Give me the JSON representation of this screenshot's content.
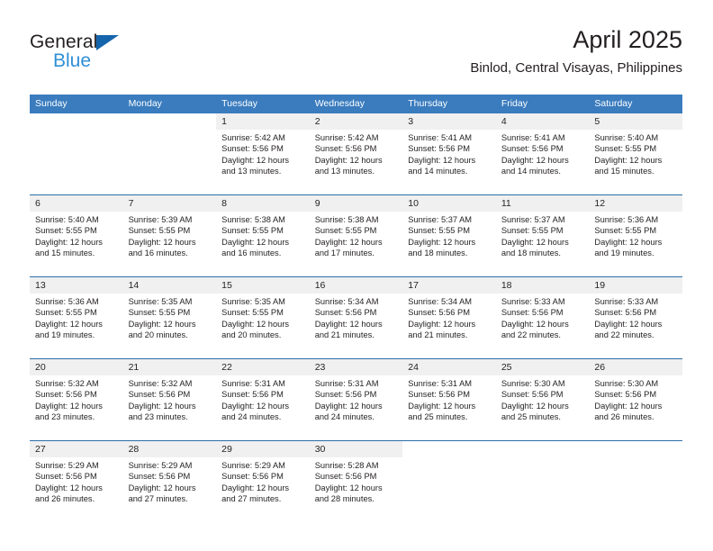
{
  "logo": {
    "primary_text": "General",
    "secondary_text": "Blue",
    "triangle_color": "#1565ad",
    "secondary_color": "#2f8fd6"
  },
  "header": {
    "title": "April 2025",
    "subtitle": "Binlod, Central Visayas, Philippines"
  },
  "theme": {
    "header_bar_color": "#3a7cbe",
    "week_divider_color": "#2e6da8",
    "date_band_color": "#f0f0f0",
    "text_color": "#231f20"
  },
  "day_headers": [
    "Sunday",
    "Monday",
    "Tuesday",
    "Wednesday",
    "Thursday",
    "Friday",
    "Saturday"
  ],
  "weeks": [
    {
      "days": [
        {
          "date": "",
          "empty": true
        },
        {
          "date": "",
          "empty": true
        },
        {
          "date": "1",
          "sunrise": "Sunrise: 5:42 AM",
          "sunset": "Sunset: 5:56 PM",
          "daylight": "Daylight: 12 hours and 13 minutes."
        },
        {
          "date": "2",
          "sunrise": "Sunrise: 5:42 AM",
          "sunset": "Sunset: 5:56 PM",
          "daylight": "Daylight: 12 hours and 13 minutes."
        },
        {
          "date": "3",
          "sunrise": "Sunrise: 5:41 AM",
          "sunset": "Sunset: 5:56 PM",
          "daylight": "Daylight: 12 hours and 14 minutes."
        },
        {
          "date": "4",
          "sunrise": "Sunrise: 5:41 AM",
          "sunset": "Sunset: 5:56 PM",
          "daylight": "Daylight: 12 hours and 14 minutes."
        },
        {
          "date": "5",
          "sunrise": "Sunrise: 5:40 AM",
          "sunset": "Sunset: 5:55 PM",
          "daylight": "Daylight: 12 hours and 15 minutes."
        }
      ]
    },
    {
      "days": [
        {
          "date": "6",
          "sunrise": "Sunrise: 5:40 AM",
          "sunset": "Sunset: 5:55 PM",
          "daylight": "Daylight: 12 hours and 15 minutes."
        },
        {
          "date": "7",
          "sunrise": "Sunrise: 5:39 AM",
          "sunset": "Sunset: 5:55 PM",
          "daylight": "Daylight: 12 hours and 16 minutes."
        },
        {
          "date": "8",
          "sunrise": "Sunrise: 5:38 AM",
          "sunset": "Sunset: 5:55 PM",
          "daylight": "Daylight: 12 hours and 16 minutes."
        },
        {
          "date": "9",
          "sunrise": "Sunrise: 5:38 AM",
          "sunset": "Sunset: 5:55 PM",
          "daylight": "Daylight: 12 hours and 17 minutes."
        },
        {
          "date": "10",
          "sunrise": "Sunrise: 5:37 AM",
          "sunset": "Sunset: 5:55 PM",
          "daylight": "Daylight: 12 hours and 18 minutes."
        },
        {
          "date": "11",
          "sunrise": "Sunrise: 5:37 AM",
          "sunset": "Sunset: 5:55 PM",
          "daylight": "Daylight: 12 hours and 18 minutes."
        },
        {
          "date": "12",
          "sunrise": "Sunrise: 5:36 AM",
          "sunset": "Sunset: 5:55 PM",
          "daylight": "Daylight: 12 hours and 19 minutes."
        }
      ]
    },
    {
      "days": [
        {
          "date": "13",
          "sunrise": "Sunrise: 5:36 AM",
          "sunset": "Sunset: 5:55 PM",
          "daylight": "Daylight: 12 hours and 19 minutes."
        },
        {
          "date": "14",
          "sunrise": "Sunrise: 5:35 AM",
          "sunset": "Sunset: 5:55 PM",
          "daylight": "Daylight: 12 hours and 20 minutes."
        },
        {
          "date": "15",
          "sunrise": "Sunrise: 5:35 AM",
          "sunset": "Sunset: 5:55 PM",
          "daylight": "Daylight: 12 hours and 20 minutes."
        },
        {
          "date": "16",
          "sunrise": "Sunrise: 5:34 AM",
          "sunset": "Sunset: 5:56 PM",
          "daylight": "Daylight: 12 hours and 21 minutes."
        },
        {
          "date": "17",
          "sunrise": "Sunrise: 5:34 AM",
          "sunset": "Sunset: 5:56 PM",
          "daylight": "Daylight: 12 hours and 21 minutes."
        },
        {
          "date": "18",
          "sunrise": "Sunrise: 5:33 AM",
          "sunset": "Sunset: 5:56 PM",
          "daylight": "Daylight: 12 hours and 22 minutes."
        },
        {
          "date": "19",
          "sunrise": "Sunrise: 5:33 AM",
          "sunset": "Sunset: 5:56 PM",
          "daylight": "Daylight: 12 hours and 22 minutes."
        }
      ]
    },
    {
      "days": [
        {
          "date": "20",
          "sunrise": "Sunrise: 5:32 AM",
          "sunset": "Sunset: 5:56 PM",
          "daylight": "Daylight: 12 hours and 23 minutes."
        },
        {
          "date": "21",
          "sunrise": "Sunrise: 5:32 AM",
          "sunset": "Sunset: 5:56 PM",
          "daylight": "Daylight: 12 hours and 23 minutes."
        },
        {
          "date": "22",
          "sunrise": "Sunrise: 5:31 AM",
          "sunset": "Sunset: 5:56 PM",
          "daylight": "Daylight: 12 hours and 24 minutes."
        },
        {
          "date": "23",
          "sunrise": "Sunrise: 5:31 AM",
          "sunset": "Sunset: 5:56 PM",
          "daylight": "Daylight: 12 hours and 24 minutes."
        },
        {
          "date": "24",
          "sunrise": "Sunrise: 5:31 AM",
          "sunset": "Sunset: 5:56 PM",
          "daylight": "Daylight: 12 hours and 25 minutes."
        },
        {
          "date": "25",
          "sunrise": "Sunrise: 5:30 AM",
          "sunset": "Sunset: 5:56 PM",
          "daylight": "Daylight: 12 hours and 25 minutes."
        },
        {
          "date": "26",
          "sunrise": "Sunrise: 5:30 AM",
          "sunset": "Sunset: 5:56 PM",
          "daylight": "Daylight: 12 hours and 26 minutes."
        }
      ]
    },
    {
      "days": [
        {
          "date": "27",
          "sunrise": "Sunrise: 5:29 AM",
          "sunset": "Sunset: 5:56 PM",
          "daylight": "Daylight: 12 hours and 26 minutes."
        },
        {
          "date": "28",
          "sunrise": "Sunrise: 5:29 AM",
          "sunset": "Sunset: 5:56 PM",
          "daylight": "Daylight: 12 hours and 27 minutes."
        },
        {
          "date": "29",
          "sunrise": "Sunrise: 5:29 AM",
          "sunset": "Sunset: 5:56 PM",
          "daylight": "Daylight: 12 hours and 27 minutes."
        },
        {
          "date": "30",
          "sunrise": "Sunrise: 5:28 AM",
          "sunset": "Sunset: 5:56 PM",
          "daylight": "Daylight: 12 hours and 28 minutes."
        },
        {
          "date": "",
          "empty": true
        },
        {
          "date": "",
          "empty": true
        },
        {
          "date": "",
          "empty": true
        }
      ]
    }
  ]
}
